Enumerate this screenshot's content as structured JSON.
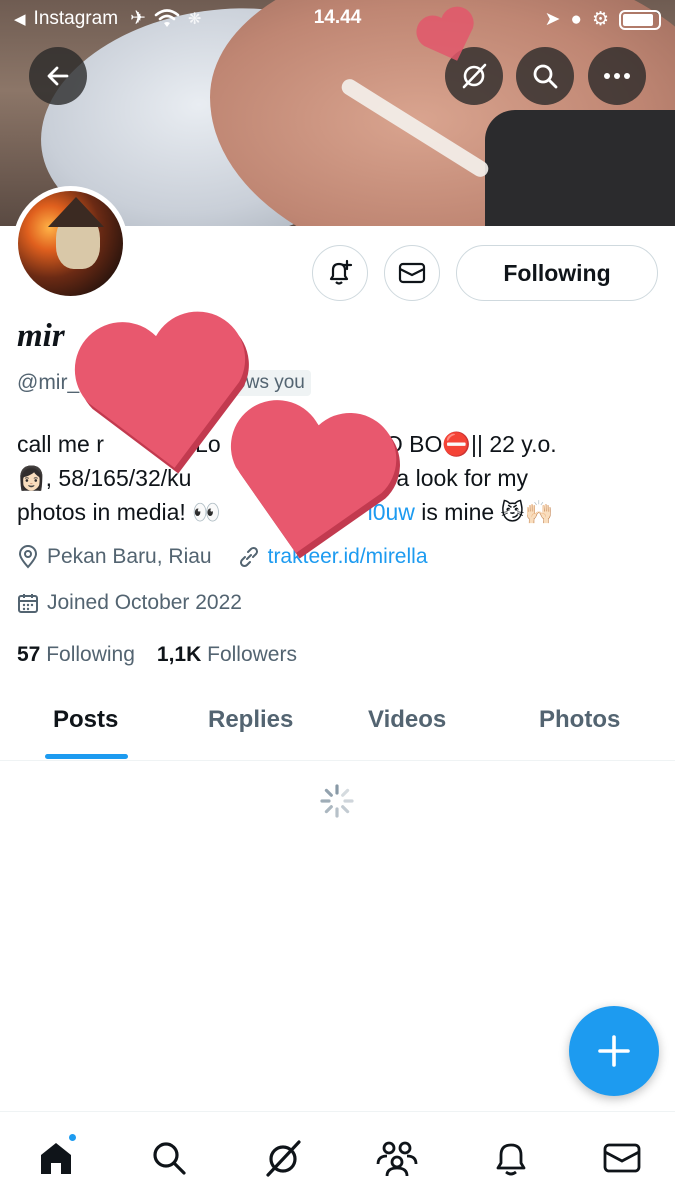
{
  "status_bar": {
    "back_app": "Instagram",
    "time": "14.44"
  },
  "header": {
    "back_icon": "arrow-left-icon",
    "grok_icon": "grok-icon",
    "search_icon": "search-icon",
    "more_icon": "more-icon"
  },
  "actions": {
    "notify_icon": "bell-plus-icon",
    "message_icon": "mail-icon",
    "following_label": "Following"
  },
  "profile": {
    "display_name": "mir",
    "handle": "@mir_",
    "follows_you": "ows you",
    "bio_line1": "call me r",
    "bio_line1b": "|| Lo",
    "bio_line1c": "nly ‼️ NO BO⛔|| 22 y.o.",
    "bio_line2": "👩🏻, 58/165/32/ku",
    "bio_line2b": "|| take a look for my",
    "bio_line3": "photos in media! 👀",
    "bio_line3_link": "l0uw",
    "bio_line3_end": " is mine 😼🙌🏻",
    "location": "Pekan Baru, Riau",
    "url": "trakteer.id/mirella",
    "joined": "Joined October 2022"
  },
  "stats": {
    "following_count": "57",
    "following_label": "Following",
    "followers_count": "1,1K",
    "followers_label": "Followers"
  },
  "tabs": [
    {
      "label": "Posts",
      "active": true
    },
    {
      "label": "Replies",
      "active": false
    },
    {
      "label": "Videos",
      "active": false
    },
    {
      "label": "Photos",
      "active": false
    }
  ],
  "bottom_nav": [
    {
      "name": "home-icon"
    },
    {
      "name": "search-icon"
    },
    {
      "name": "grok-icon"
    },
    {
      "name": "communities-icon"
    },
    {
      "name": "notifications-icon"
    },
    {
      "name": "messages-icon"
    }
  ],
  "colors": {
    "accent": "#1d9bf0",
    "text": "#0f1419",
    "secondary": "#536471",
    "heart": "#e8586e"
  }
}
